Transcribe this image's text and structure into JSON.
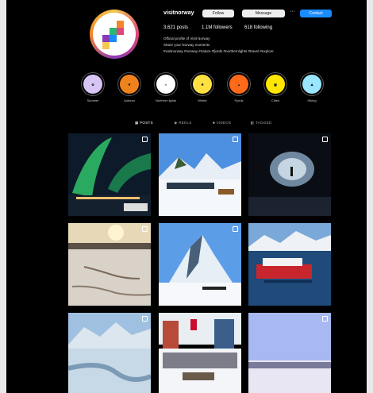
{
  "profile": {
    "username": "visitnorway",
    "follow_label": "Follow",
    "message_label": "Message",
    "contact_label": "Contact",
    "more_label": "···",
    "posts": "3,621 posts",
    "followers": "1.1M followers",
    "following": "618 following",
    "bio": [
      "Official profile of Visit Norway",
      "Share your Norway moments",
      "#visitnorway #norway #nature #fjords #northernlights #travel #explore"
    ]
  },
  "highlights": [
    {
      "label": "Summer",
      "color": "#d7c6f5",
      "icon": "flower-icon"
    },
    {
      "label": "Autumn",
      "color": "#f0821e",
      "icon": "leaf-icon"
    },
    {
      "label": "Northern lights",
      "color": "#ffffff",
      "icon": "aurora-icon"
    },
    {
      "label": "Winter",
      "color": "#ffe042",
      "icon": "snowflake-icon"
    },
    {
      "label": "Fjords",
      "color": "#ff6a1a",
      "icon": "mountain-icon"
    },
    {
      "label": "Cities",
      "color": "#ffe600",
      "icon": "building-icon"
    },
    {
      "label": "Hiking",
      "color": "#9be6ff",
      "icon": "hiking-icon"
    }
  ],
  "tabs": [
    {
      "label": "POSTS",
      "icon": "grid-icon"
    },
    {
      "label": "REELS",
      "icon": "reels-icon"
    },
    {
      "label": "VIDEOS",
      "icon": "video-icon"
    },
    {
      "label": "TAGGED",
      "icon": "tag-icon"
    }
  ],
  "posts": [
    {
      "scene": "aurora-over-harbor",
      "multi": true
    },
    {
      "scene": "dog-sled-snow",
      "multi": true
    },
    {
      "scene": "ice-cave",
      "multi": true
    },
    {
      "scene": "frozen-fjord-sunset",
      "multi": true
    },
    {
      "scene": "snowy-peak-skiers",
      "multi": true
    },
    {
      "scene": "coastal-ferry",
      "multi": false
    },
    {
      "scene": "frozen-river-valley",
      "multi": true
    },
    {
      "scene": "sled-dog-race",
      "multi": false
    },
    {
      "scene": "pink-twilight-town",
      "multi": true
    }
  ],
  "colors": {
    "accent": "#1a8cff",
    "background": "#000000"
  }
}
